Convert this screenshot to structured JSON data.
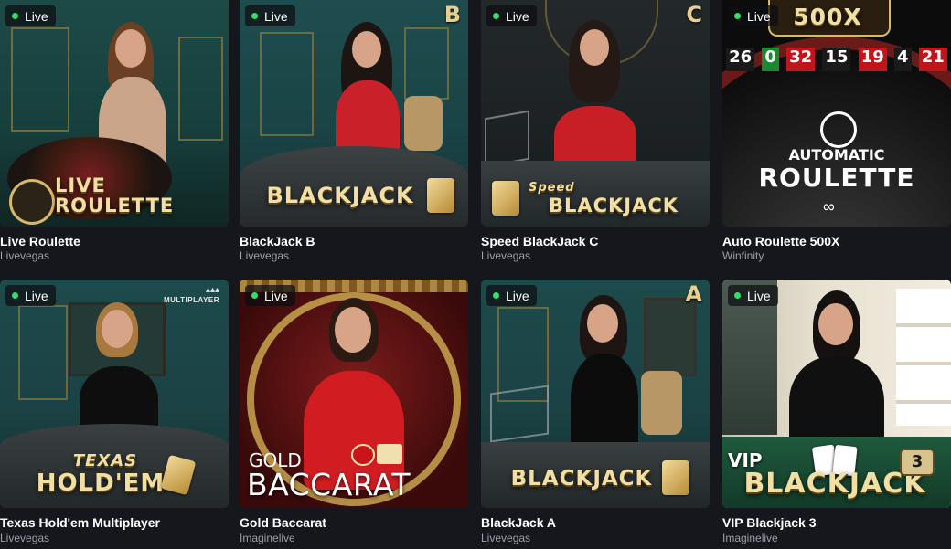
{
  "live_label": "Live",
  "games": [
    {
      "title": "Live Roulette",
      "provider": "Livevegas",
      "logo": "LIVE\nROULETTE",
      "letter": ""
    },
    {
      "title": "BlackJack B",
      "provider": "Livevegas",
      "logo": "BLACKJACK",
      "letter": "B"
    },
    {
      "title": "Speed BlackJack C",
      "provider": "Livevegas",
      "logo": "BLACKJACK",
      "logo_small": "Speed",
      "letter": "C"
    },
    {
      "title": "Auto Roulette 500X",
      "provider": "Winfinity",
      "logo_top": "AUTOMATIC",
      "logo": "ROULETTE",
      "badge": "500X",
      "wheel_numbers": [
        "26",
        "0",
        "32",
        "15",
        "19",
        "4",
        "21"
      ]
    },
    {
      "title": "Texas Hold'em Multiplayer",
      "provider": "Livevegas",
      "logo_top": "TEXAS",
      "logo": "HOLD'EM",
      "tag": "MULTIPLAYER"
    },
    {
      "title": "Gold Baccarat",
      "provider": "Imaginelive",
      "logo_top": "GOLD",
      "logo": "BACCARAT"
    },
    {
      "title": "BlackJack A",
      "provider": "Livevegas",
      "logo": "BLACKJACK",
      "letter": "A"
    },
    {
      "title": "VIP Blackjack 3",
      "provider": "Imaginelive",
      "logo_top": "VIP",
      "logo": "BLACKJACK",
      "letter": "3"
    }
  ],
  "colors": {
    "background": "#15171c",
    "live_dot": "#2fe06a",
    "gold_text": "#f2dfa3",
    "provider_text": "#9aa0a8"
  }
}
